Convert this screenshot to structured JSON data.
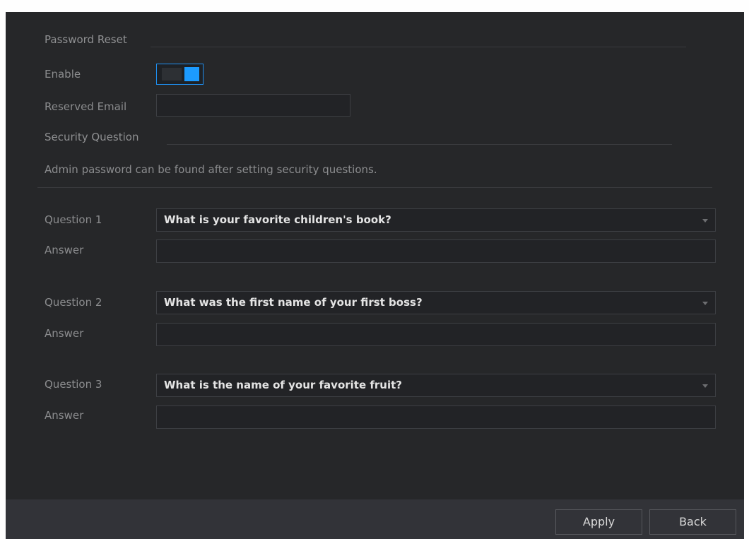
{
  "page": {
    "heading": "Password Reset",
    "enable_label": "Enable",
    "enable_state": true,
    "email_label": "Reserved Email",
    "email_value": "",
    "security_heading": "Security Question",
    "hint": "Admin password can be found after setting security questions."
  },
  "questions": [
    {
      "label": "Question 1",
      "selected": "What is your favorite children's book?",
      "answer_label": "Answer",
      "answer_value": ""
    },
    {
      "label": "Question 2",
      "selected": "What was the first name of your first boss?",
      "answer_label": "Answer",
      "answer_value": ""
    },
    {
      "label": "Question 3",
      "selected": "What is the name of your favorite fruit?",
      "answer_label": "Answer",
      "answer_value": ""
    }
  ],
  "footer": {
    "apply_label": "Apply",
    "back_label": "Back"
  },
  "colors": {
    "panel": "#262729",
    "accent": "#1c9bff",
    "footer": "#323338"
  }
}
